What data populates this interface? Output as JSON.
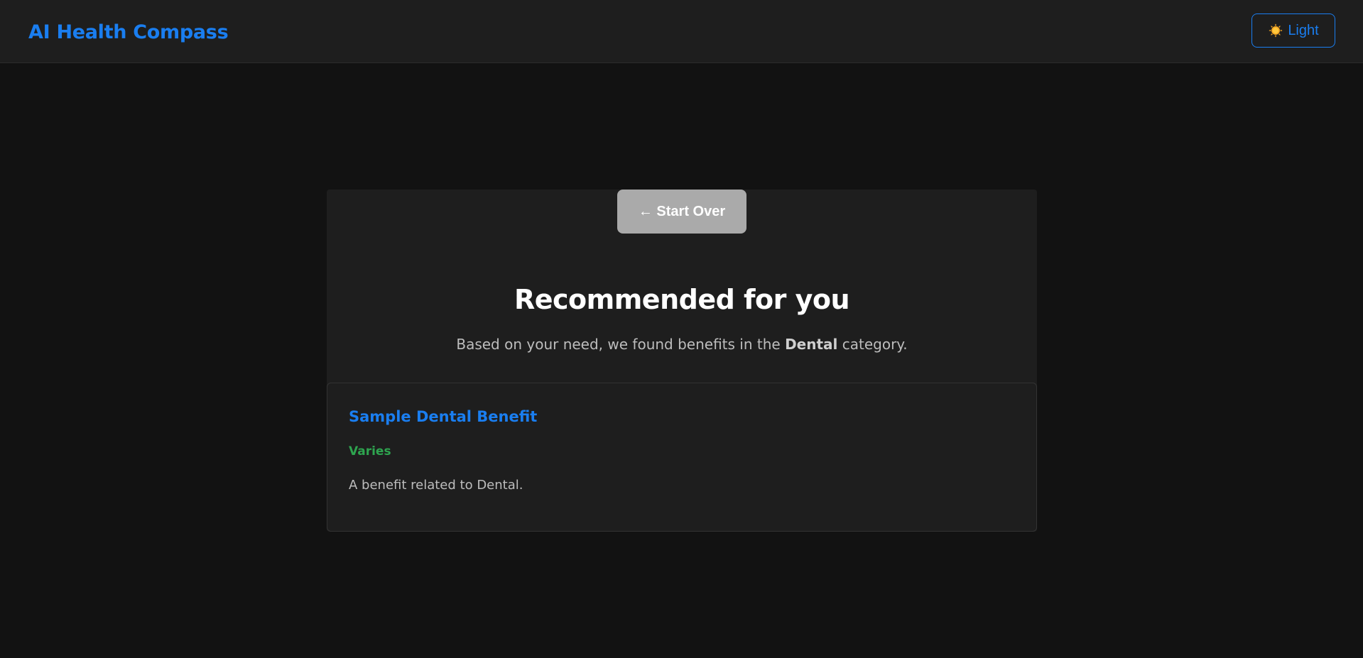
{
  "header": {
    "brand": "AI Health Compass",
    "theme_toggle": {
      "icon": "sun-icon",
      "label": "Light"
    }
  },
  "results": {
    "start_over_label": "← Start Over",
    "title": "Recommended for you",
    "subtitle_prefix": "Based on your need, we found benefits in the ",
    "category": "Dental",
    "subtitle_suffix": " category.",
    "benefits": [
      {
        "name": "Sample Dental Benefit",
        "amount": "Varies",
        "description": "A benefit related to Dental."
      }
    ]
  },
  "colors": {
    "accent": "#1a7ef0",
    "success": "#2ea44f",
    "background": "#121212",
    "surface": "#1e1e1e"
  }
}
